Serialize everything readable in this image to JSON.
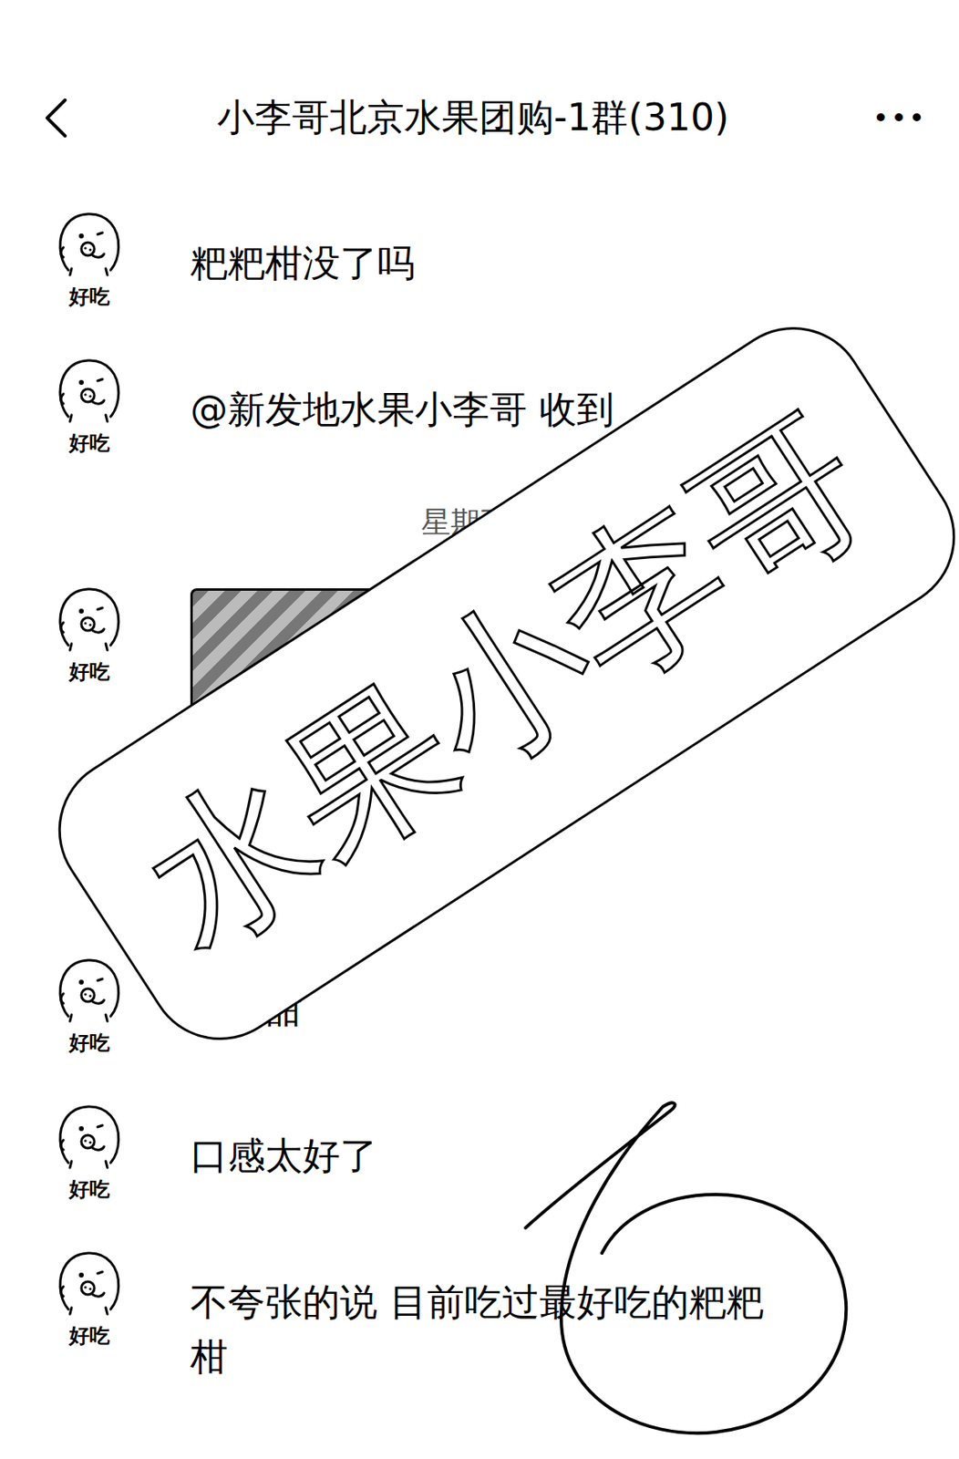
{
  "header": {
    "title": "小李哥北京水果团购-1群(310)",
    "more": "•••"
  },
  "messages": [
    {
      "kind": "text",
      "sender": "好吃",
      "text": "粑粑柑没了吗"
    },
    {
      "kind": "text",
      "sender": "好吃",
      "text": "@新发地水果小李哥 收到"
    },
    {
      "kind": "time",
      "text": "星期五 1"
    },
    {
      "kind": "image",
      "sender": "好吃"
    },
    {
      "kind": "text",
      "sender": "好吃",
      "text": "甜不甜"
    },
    {
      "kind": "text",
      "sender": "好吃",
      "text": "口感太好了"
    },
    {
      "kind": "text",
      "sender": "好吃",
      "text": "不夸张的说 目前吃过最好吃的粑粑柑"
    }
  ],
  "watermark": "水果小李哥"
}
